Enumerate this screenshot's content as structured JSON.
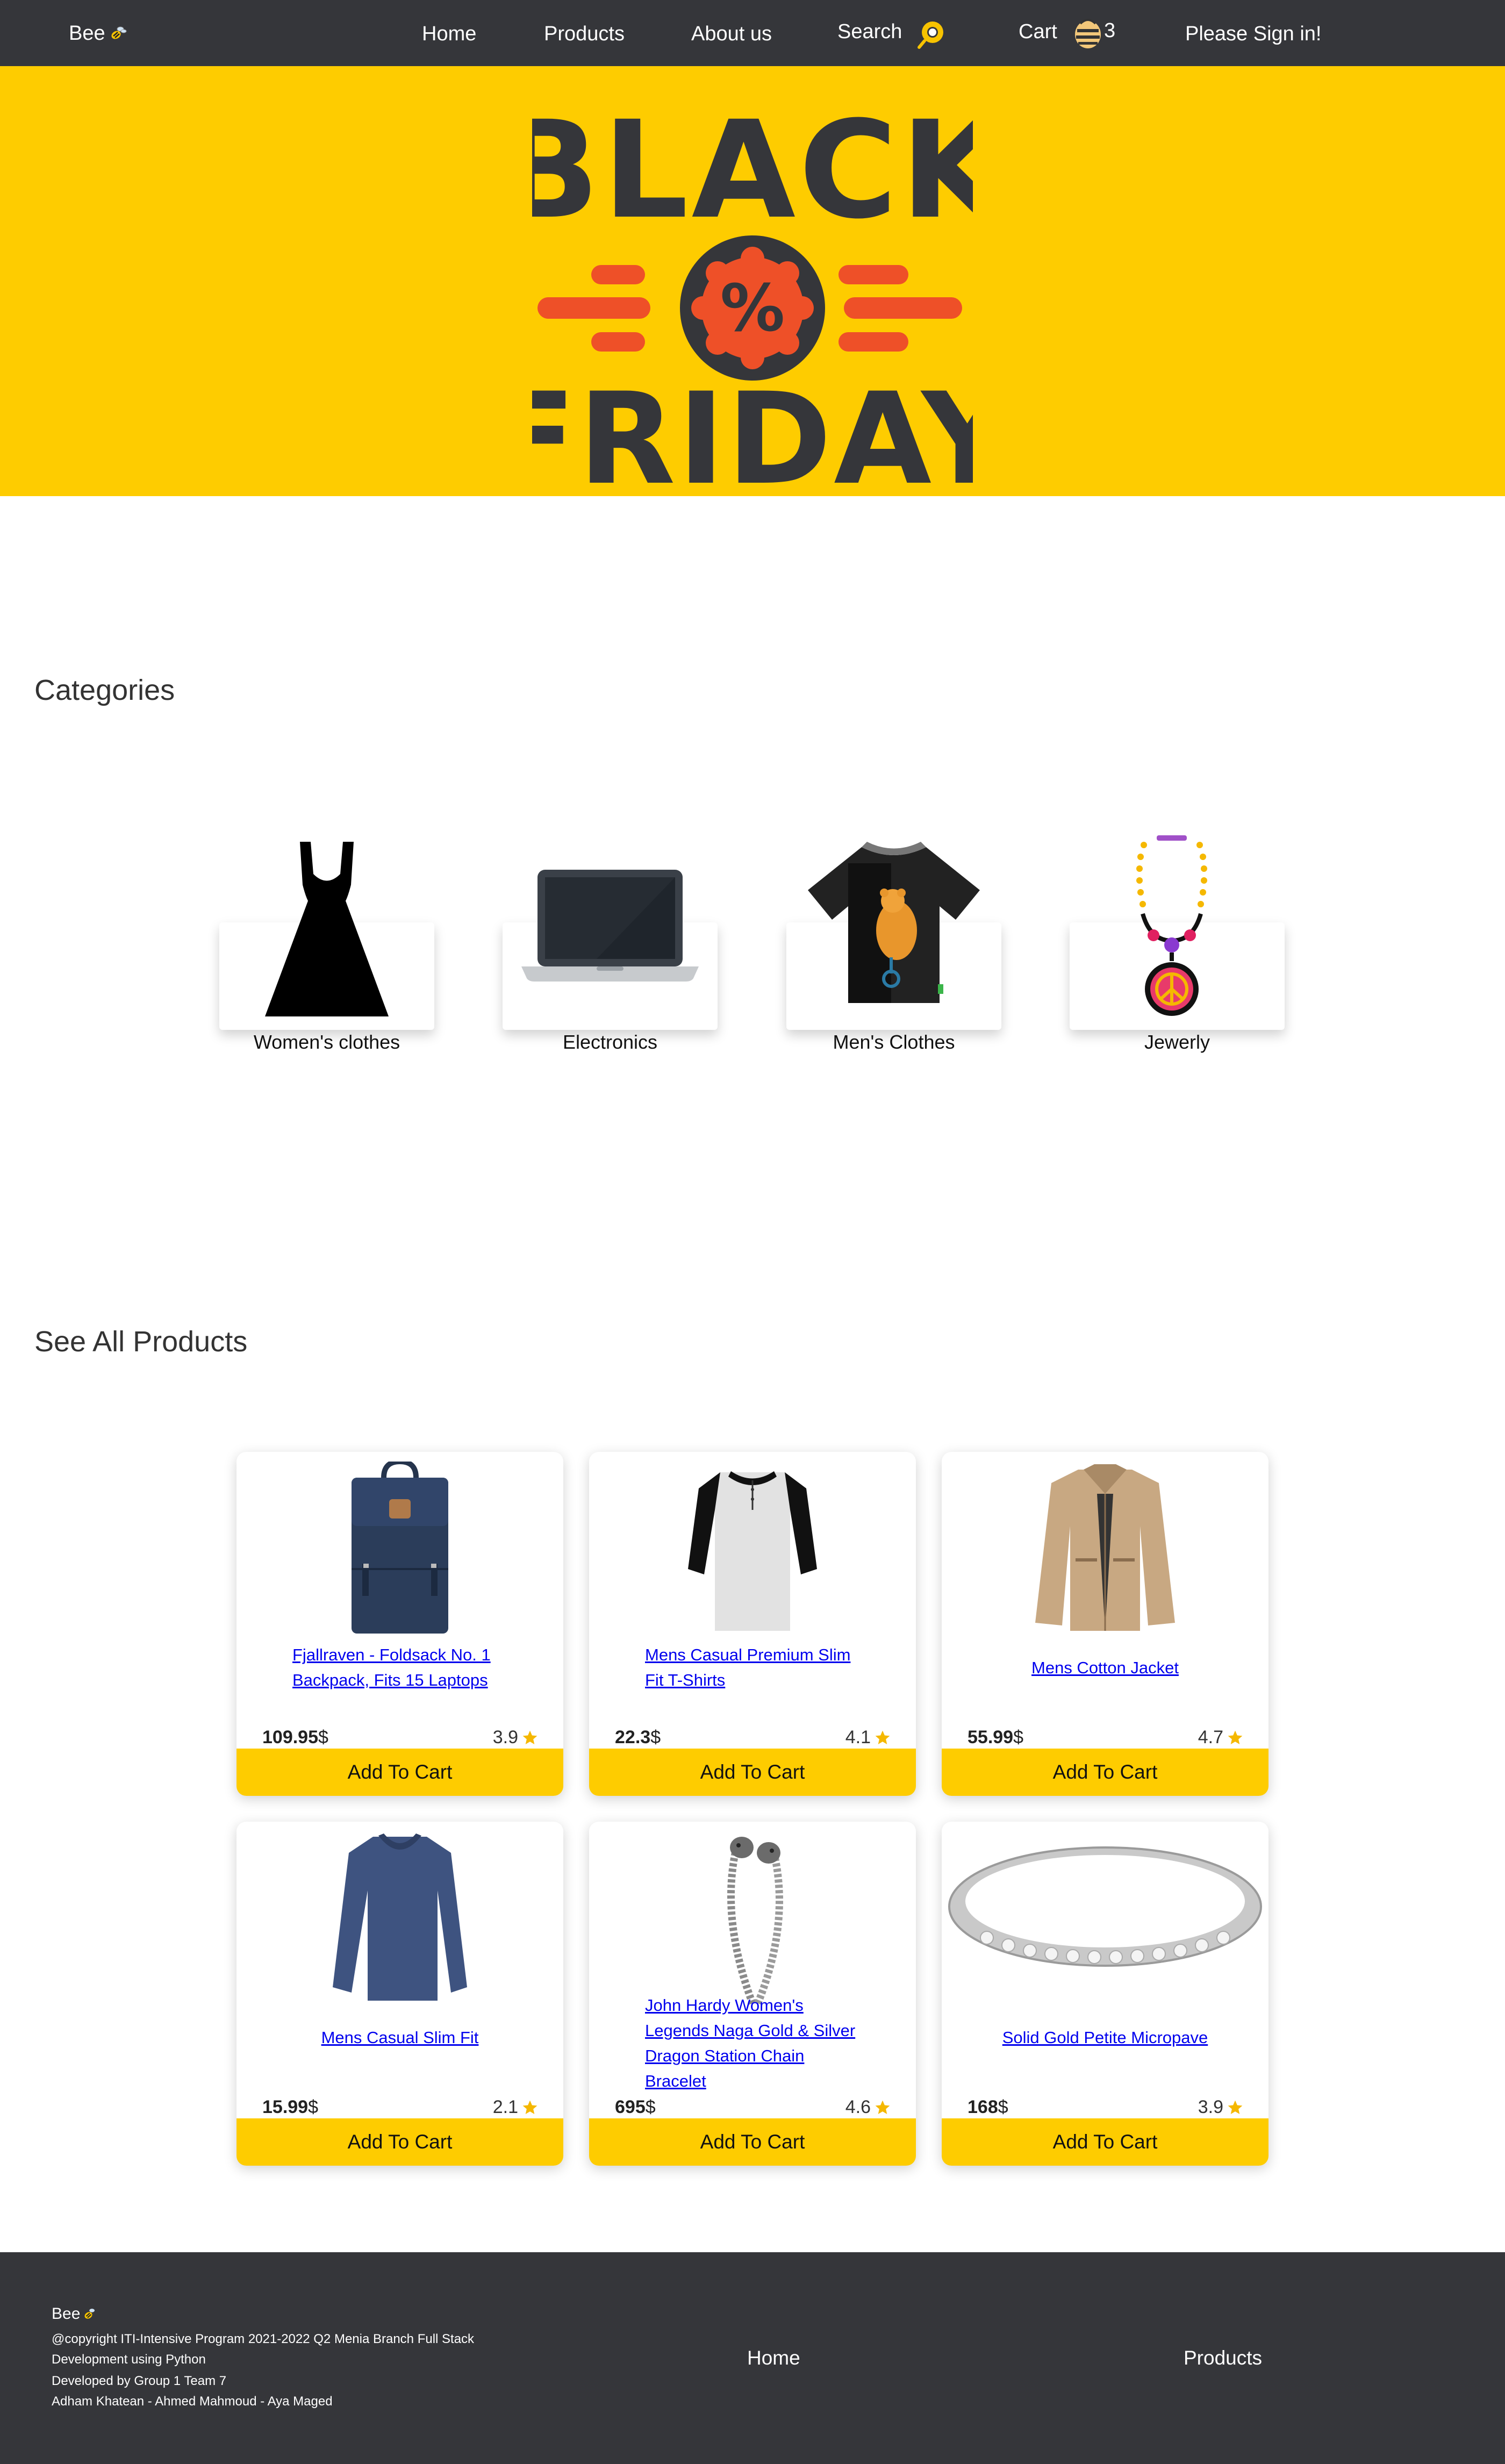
{
  "navbar": {
    "brand": "Bee",
    "links": [
      "Home",
      "Products",
      "About us"
    ],
    "search_label": "Search",
    "cart_label": "Cart",
    "cart_count": "3",
    "signin_label": "Please Sign in!"
  },
  "hero": {
    "line1": "BLACK",
    "line2": "FRIDAY",
    "badge_symbol": "%"
  },
  "categories": {
    "title": "Categories",
    "items": [
      {
        "label": "Women's clothes",
        "icon": "dress-icon"
      },
      {
        "label": "Electronics",
        "icon": "laptop-icon"
      },
      {
        "label": "Men's Clothes",
        "icon": "tshirt-icon"
      },
      {
        "label": "Jewerly",
        "icon": "necklace-icon"
      }
    ]
  },
  "products": {
    "title": "See All Products",
    "add_label": "Add To Cart",
    "currency": "$",
    "items": [
      {
        "title": "Fjallraven - Foldsack No. 1 Backpack, Fits 15 Laptops",
        "price": "109.95",
        "rating": "3.9",
        "icon": "backpack-icon"
      },
      {
        "title": "Mens Casual Premium Slim Fit T-Shirts",
        "price": "22.3",
        "rating": "4.1",
        "icon": "henley-shirt-icon"
      },
      {
        "title": "Mens Cotton Jacket",
        "price": "55.99",
        "rating": "4.7",
        "icon": "jacket-icon"
      },
      {
        "title": "Mens Casual Slim Fit",
        "price": "15.99",
        "rating": "2.1",
        "icon": "longsleeve-shirt-icon"
      },
      {
        "title": "John Hardy Women's Legends Naga Gold & Silver Dragon Station Chain Bracelet",
        "price": "695",
        "rating": "4.6",
        "icon": "chain-bracelet-icon"
      },
      {
        "title": "Solid Gold Petite Micropave",
        "price": "168",
        "rating": "3.9",
        "icon": "ring-icon"
      }
    ]
  },
  "footer": {
    "brand": "Bee",
    "lines": [
      "@copyright ITI-Intensive Program 2021-2022 Q2 Menia Branch Full Stack",
      "Development using Python",
      "Developed by Group 1 Team 7",
      "Adham Khatean - Ahmed Mahmoud - Aya Maged"
    ],
    "links": [
      "Home",
      "Products"
    ]
  },
  "colors": {
    "accent": "#fecc00",
    "dark": "#35363a",
    "hero_orange": "#ee5028",
    "link": "#0000ee"
  }
}
